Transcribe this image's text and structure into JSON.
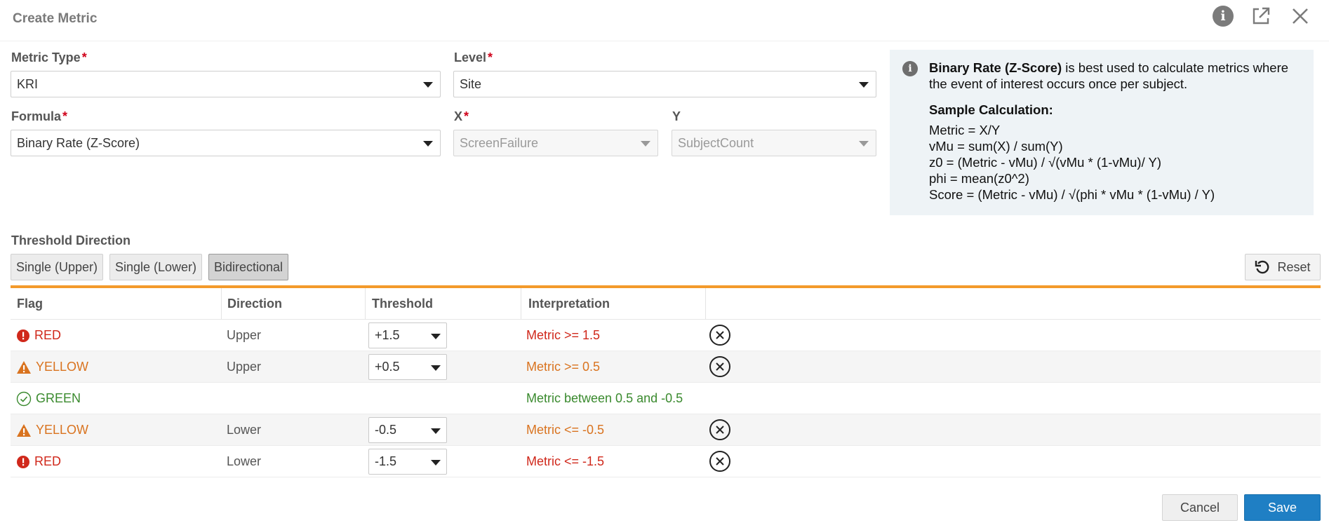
{
  "dialog": {
    "title": "Create Metric"
  },
  "header_icons": [
    "info-icon",
    "open-external-icon",
    "close-icon"
  ],
  "form": {
    "metric_type": {
      "label": "Metric Type",
      "value": "KRI"
    },
    "level": {
      "label": "Level",
      "value": "Site"
    },
    "formula": {
      "label": "Formula",
      "value": "Binary Rate (Z-Score)"
    },
    "x": {
      "label": "X",
      "value": "ScreenFailure"
    },
    "y": {
      "label": "Y",
      "value": "SubjectCount"
    },
    "required_mark": "*"
  },
  "info_panel": {
    "formula_name": "Binary Rate (Z-Score)",
    "description": " is best used to calculate metrics where the event of interest occurs once per subject.",
    "sample_title": "Sample Calculation:",
    "lines": [
      "Metric = X/Y",
      "vMu = sum(X) / sum(Y)",
      "z0 = (Metric - vMu) / √(vMu * (1-vMu)/ Y)",
      "phi = mean(z0^2)",
      "Score = (Metric - vMu) / √(phi * vMu * (1-vMu) / Y)"
    ]
  },
  "threshold_direction": {
    "label": "Threshold Direction",
    "options": [
      "Single (Upper)",
      "Single (Lower)",
      "Bidirectional"
    ],
    "selected": "Bidirectional",
    "reset_label": "Reset"
  },
  "table": {
    "columns": [
      "Flag",
      "Direction",
      "Threshold",
      "Interpretation"
    ],
    "rows": [
      {
        "flag": "RED",
        "direction": "Upper",
        "threshold": "+1.5",
        "interpretation": "Metric >= 1.5"
      },
      {
        "flag": "YELLOW",
        "direction": "Upper",
        "threshold": "+0.5",
        "interpretation": "Metric >= 0.5"
      },
      {
        "flag": "GREEN",
        "direction": "",
        "threshold": "",
        "interpretation": "Metric between 0.5 and -0.5"
      },
      {
        "flag": "YELLOW",
        "direction": "Lower",
        "threshold": "-0.5",
        "interpretation": "Metric <= -0.5"
      },
      {
        "flag": "RED",
        "direction": "Lower",
        "threshold": "-1.5",
        "interpretation": "Metric <= -1.5"
      }
    ]
  },
  "footer": {
    "cancel_label": "Cancel",
    "save_label": "Save"
  },
  "colors": {
    "red": "#d0281b",
    "yellow": "#d9731f",
    "green": "#3a8a2e",
    "accent_orange": "#f39a2b",
    "primary_blue": "#1f7fc4"
  }
}
